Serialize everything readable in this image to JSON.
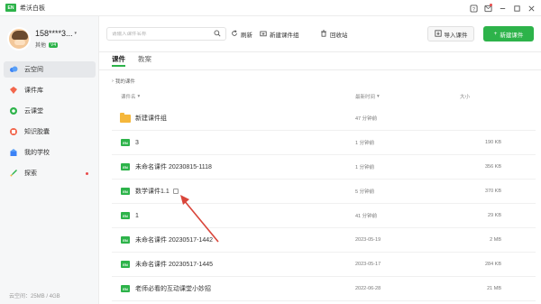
{
  "window": {
    "title": "希沃白板",
    "logo_text": "EN"
  },
  "profile": {
    "name": "158****3...",
    "caret": "▾",
    "role": "其他",
    "badge": "V4"
  },
  "sidebar": {
    "items": [
      {
        "label": "云空间",
        "icon": "cloud-icon",
        "color": "#3b82f6"
      },
      {
        "label": "课件库",
        "icon": "courseware-library-icon",
        "color": "#f2664c"
      },
      {
        "label": "云课堂",
        "icon": "cloud-class-icon",
        "color": "#2db34a"
      },
      {
        "label": "知识胶囊",
        "icon": "knowledge-capsule-icon",
        "color": "#f2664c"
      },
      {
        "label": "我的学校",
        "icon": "school-icon",
        "color": "#3b82f6"
      },
      {
        "label": "探索",
        "icon": "rocket-icon",
        "color": "#2db34a"
      }
    ],
    "storage": "云空间：25MB / 4GB"
  },
  "toolbar": {
    "search_placeholder": "请输入课件名称",
    "refresh_label": "刷新",
    "new_group_label": "新建课件组",
    "recycle_label": "回收站",
    "import_label": "导入课件",
    "new_label": "新建课件"
  },
  "tabs": [
    {
      "label": "课件",
      "active": true
    },
    {
      "label": "教案",
      "active": false
    }
  ],
  "breadcrumb": "我的课件",
  "table": {
    "headers": {
      "name": "课件名",
      "updated": "最新时间",
      "size": "大小"
    },
    "rows": [
      {
        "type": "folder",
        "name": "新建课件组",
        "updated": "47 分钟前",
        "size": ""
      },
      {
        "type": "file",
        "name": "3",
        "updated": "1 分钟前",
        "size": "190 KB"
      },
      {
        "type": "file",
        "name": "未命名课件 20230815-1118",
        "updated": "1 分钟前",
        "size": "356 KB"
      },
      {
        "type": "file",
        "name": "数学课件1.1",
        "updated": "5 分钟前",
        "size": "370 KB",
        "shared": true
      },
      {
        "type": "file",
        "name": "1",
        "updated": "41 分钟前",
        "size": "29 KB"
      },
      {
        "type": "file",
        "name": "未命名课件 20230517-1442",
        "updated": "2023-05-19",
        "size": "2 MB"
      },
      {
        "type": "file",
        "name": "未命名课件 20230517-1445",
        "updated": "2023-05-17",
        "size": "284 KB"
      },
      {
        "type": "file",
        "name": "老师必看的互动课堂小妙招",
        "updated": "2022-06-28",
        "size": "21 MB"
      }
    ]
  },
  "colors": {
    "accent": "#2db34a",
    "annotation": "#d9453a"
  }
}
